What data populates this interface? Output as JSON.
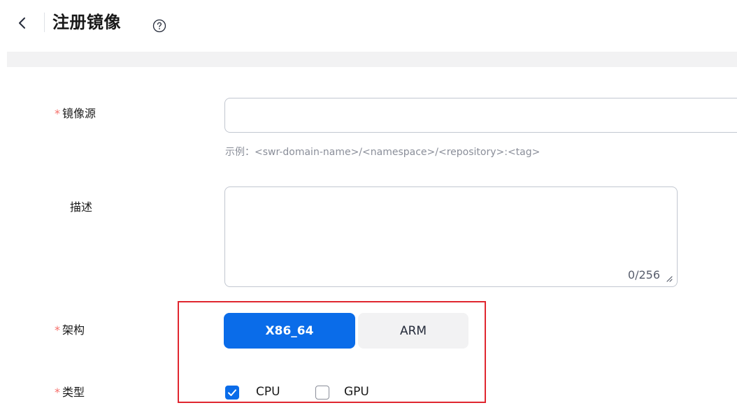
{
  "header": {
    "title": "注册镜像"
  },
  "form": {
    "source": {
      "label": "镜像源",
      "required_mark": "*",
      "value": "",
      "hint": "示例：<swr-domain-name>/<namespace>/<repository>:<tag>"
    },
    "description": {
      "label": "描述",
      "value": "",
      "counter": "0/256"
    },
    "architecture": {
      "label": "架构",
      "required_mark": "*",
      "options": [
        "X86_64",
        "ARM"
      ],
      "selected": "X86_64"
    },
    "type": {
      "label": "类型",
      "required_mark": "*",
      "options": [
        {
          "label": "CPU",
          "checked": true
        },
        {
          "label": "GPU",
          "checked": false
        }
      ]
    }
  },
  "colors": {
    "accent": "#0a6ce9",
    "required": "#f66f6a",
    "highlight_border": "#e0262f"
  },
  "icons": [
    "chevron-left-icon",
    "help-circle-icon",
    "resize-handle-icon",
    "check-icon"
  ]
}
